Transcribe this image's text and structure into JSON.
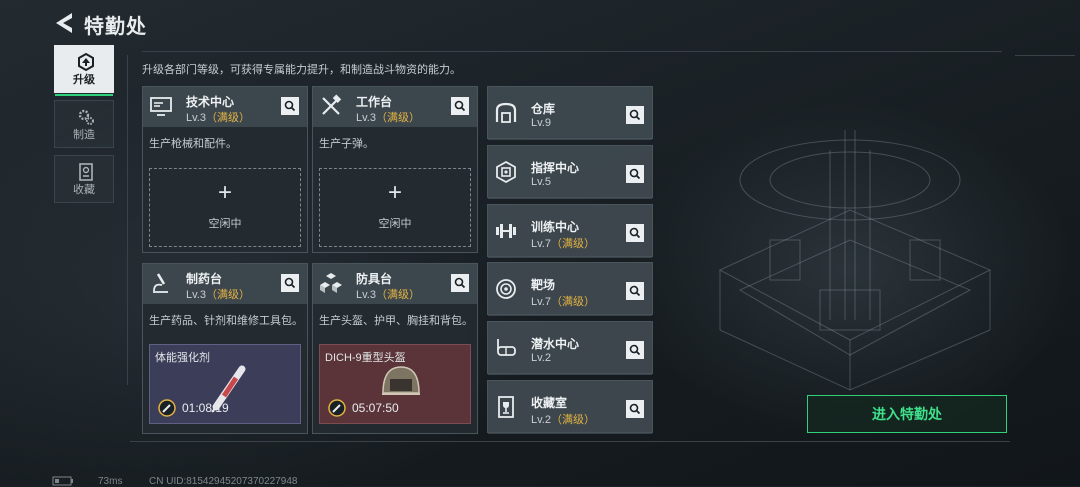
{
  "header": {
    "title": "特勤处"
  },
  "tabs": [
    {
      "label": "升级",
      "active": true,
      "icon": "upgrade-icon"
    },
    {
      "label": "制造",
      "active": false,
      "icon": "gears-icon"
    },
    {
      "label": "收藏",
      "active": false,
      "icon": "collection-icon"
    }
  ],
  "intro": "升级各部门等级，可获得专属能力提升，和制造战斗物资的能力。",
  "cards": [
    {
      "name": "技术中心",
      "level": "Lv.3",
      "max": "（满级）",
      "desc": "生产枪械和配件。",
      "plus": "+",
      "status": "空闲中",
      "icon": "monitor-icon"
    },
    {
      "name": "工作台",
      "level": "Lv.3",
      "max": "（满级）",
      "desc": "生产子弹。",
      "plus": "+",
      "status": "空闲中",
      "icon": "tools-icon"
    },
    {
      "name": "制药台",
      "level": "Lv.3",
      "max": "（满级）",
      "desc": "生产药品、针剂和维修工具包。",
      "product": "体能强化剂",
      "timer": "01:08:19",
      "icon": "microscope-icon"
    },
    {
      "name": "防具台",
      "level": "Lv.3",
      "max": "（满级）",
      "desc": "生产头盔、护甲、胸挂和背包。",
      "product": "DICH-9重型头盔",
      "timer": "05:07:50",
      "icon": "cubes-icon"
    }
  ],
  "facilities": [
    {
      "name": "仓库",
      "level": "Lv.9",
      "max": "",
      "icon": "warehouse-icon"
    },
    {
      "name": "指挥中心",
      "level": "Lv.5",
      "max": "",
      "icon": "chip-icon"
    },
    {
      "name": "训练中心",
      "level": "Lv.7",
      "max": "（满级）",
      "icon": "dumbbell-icon"
    },
    {
      "name": "靶场",
      "level": "Lv.7",
      "max": "（满级）",
      "icon": "target-icon"
    },
    {
      "name": "潜水中心",
      "level": "Lv.2",
      "max": "",
      "icon": "diving-mask-icon"
    },
    {
      "name": "收藏室",
      "level": "Lv.2",
      "max": "（满级）",
      "icon": "trophy-icon"
    }
  ],
  "enter_button": "进入特勤处",
  "footer": {
    "ping": "73ms",
    "uid": "CN UID:815429452073702279​48"
  },
  "colors": {
    "accent": "#2fd27a",
    "max_level": "#e3b343",
    "pharma_bg": "#3b3d59",
    "armor_bg": "#5a3438"
  }
}
